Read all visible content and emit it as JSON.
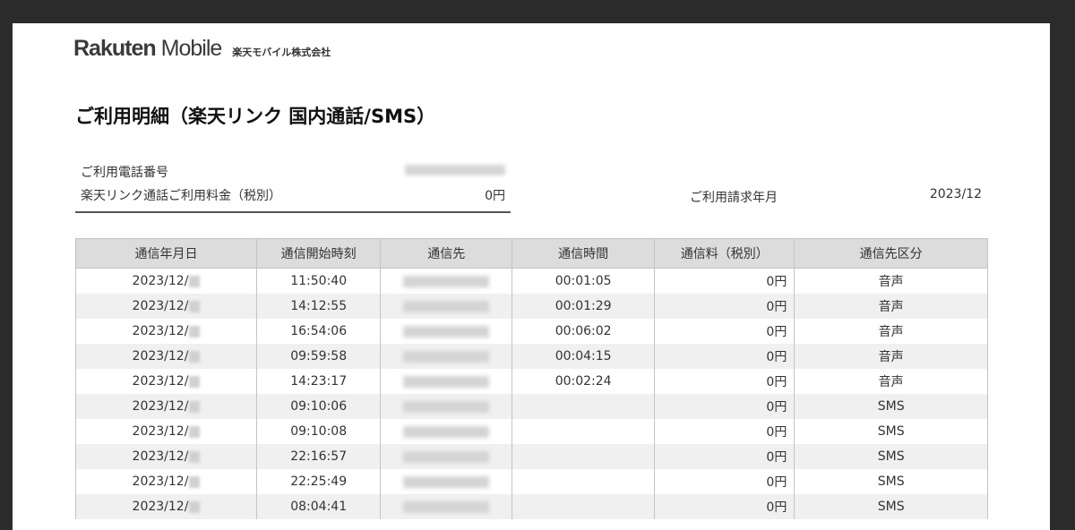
{
  "header": {
    "brand_part1": "Rakuten",
    "brand_part2": "Mobile",
    "company": "楽天モバイル株式会社"
  },
  "title": "ご利用明細（楽天リンク 国内通話/SMS）",
  "summary": {
    "phone_label": "ご利用電話番号",
    "fee_label": "楽天リンク通話ご利用料金（税別）",
    "fee_value": "0円",
    "billing_label": "ご利用請求年月",
    "billing_value": "2023/12"
  },
  "table": {
    "headers": [
      "通信年月日",
      "通信開始時刻",
      "通信先",
      "通信時間",
      "通信料（税別）",
      "通信先区分"
    ],
    "rows": [
      {
        "date_prefix": "2023/12/",
        "start": "11:50:40",
        "duration": "00:01:05",
        "fee": "0円",
        "category": "音声"
      },
      {
        "date_prefix": "2023/12/",
        "start": "14:12:55",
        "duration": "00:01:29",
        "fee": "0円",
        "category": "音声"
      },
      {
        "date_prefix": "2023/12/",
        "start": "16:54:06",
        "duration": "00:06:02",
        "fee": "0円",
        "category": "音声"
      },
      {
        "date_prefix": "2023/12/",
        "start": "09:59:58",
        "duration": "00:04:15",
        "fee": "0円",
        "category": "音声"
      },
      {
        "date_prefix": "2023/12/",
        "start": "14:23:17",
        "duration": "00:02:24",
        "fee": "0円",
        "category": "音声"
      },
      {
        "date_prefix": "2023/12/",
        "start": "09:10:06",
        "duration": "",
        "fee": "0円",
        "category": "SMS"
      },
      {
        "date_prefix": "2023/12/",
        "start": "09:10:08",
        "duration": "",
        "fee": "0円",
        "category": "SMS"
      },
      {
        "date_prefix": "2023/12/",
        "start": "22:16:57",
        "duration": "",
        "fee": "0円",
        "category": "SMS"
      },
      {
        "date_prefix": "2023/12/",
        "start": "22:25:49",
        "duration": "",
        "fee": "0円",
        "category": "SMS"
      },
      {
        "date_prefix": "2023/12/",
        "start": "08:04:41",
        "duration": "",
        "fee": "0円",
        "category": "SMS"
      }
    ]
  }
}
